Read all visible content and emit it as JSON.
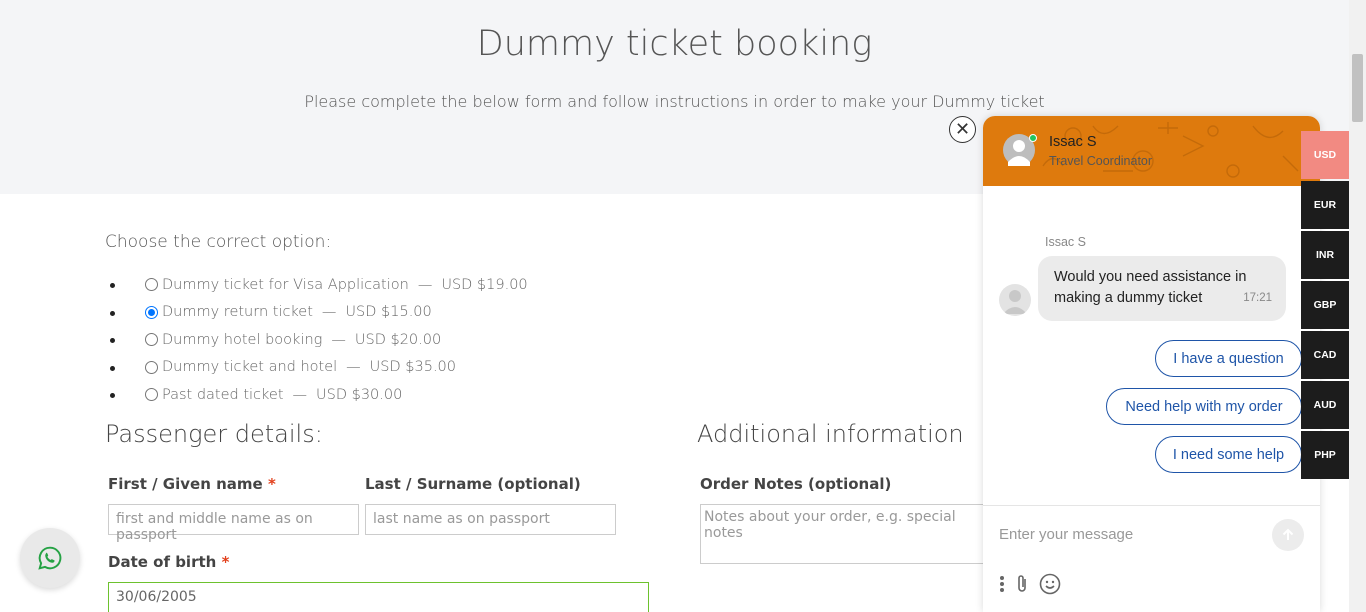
{
  "hero": {
    "title": "Dummy ticket booking",
    "subtitle": "Please complete the below form and follow instructions in order to make your Dummy ticket"
  },
  "choose": {
    "label": "Choose the correct option:",
    "options": [
      {
        "label": "Dummy ticket for Visa Application",
        "sep": "—",
        "price": "USD $19.00",
        "selected": false
      },
      {
        "label": "Dummy return ticket",
        "sep": "—",
        "price": "USD $15.00",
        "selected": true
      },
      {
        "label": "Dummy hotel booking",
        "sep": "—",
        "price": "USD $20.00",
        "selected": false
      },
      {
        "label": "Dummy ticket and hotel",
        "sep": "—",
        "price": "USD $35.00",
        "selected": false
      },
      {
        "label": "Past dated ticket",
        "sep": "—",
        "price": "USD $30.00",
        "selected": false
      }
    ]
  },
  "passenger": {
    "title": "Passenger details:",
    "first_name_label": "First / Given name",
    "required_mark": "*",
    "first_name_placeholder": "first and middle name as on passport",
    "last_name_label": "Last / Surname (optional)",
    "last_name_placeholder": "last name as on passport",
    "dob_label": "Date of birth",
    "dob_value": "30/06/2005"
  },
  "additional": {
    "title": "Additional information",
    "notes_label": "Order Notes (optional)",
    "notes_placeholder": "Notes about your order, e.g. special notes"
  },
  "chat": {
    "agent_name": "Issac S",
    "agent_role": "Travel Coordinator",
    "sender": "Issac S",
    "message": "Would you need assistance in making a dummy ticket",
    "time": "17:21",
    "quick_replies": [
      "I have a question",
      "Need help with my order",
      "I need some help"
    ],
    "input_placeholder": "Enter your message",
    "close_icon": "close-icon",
    "header_color": "#de7a0d"
  },
  "currencies": {
    "items": [
      "USD",
      "EUR",
      "INR",
      "GBP",
      "CAD",
      "AUD",
      "PHP"
    ],
    "active": "USD"
  }
}
